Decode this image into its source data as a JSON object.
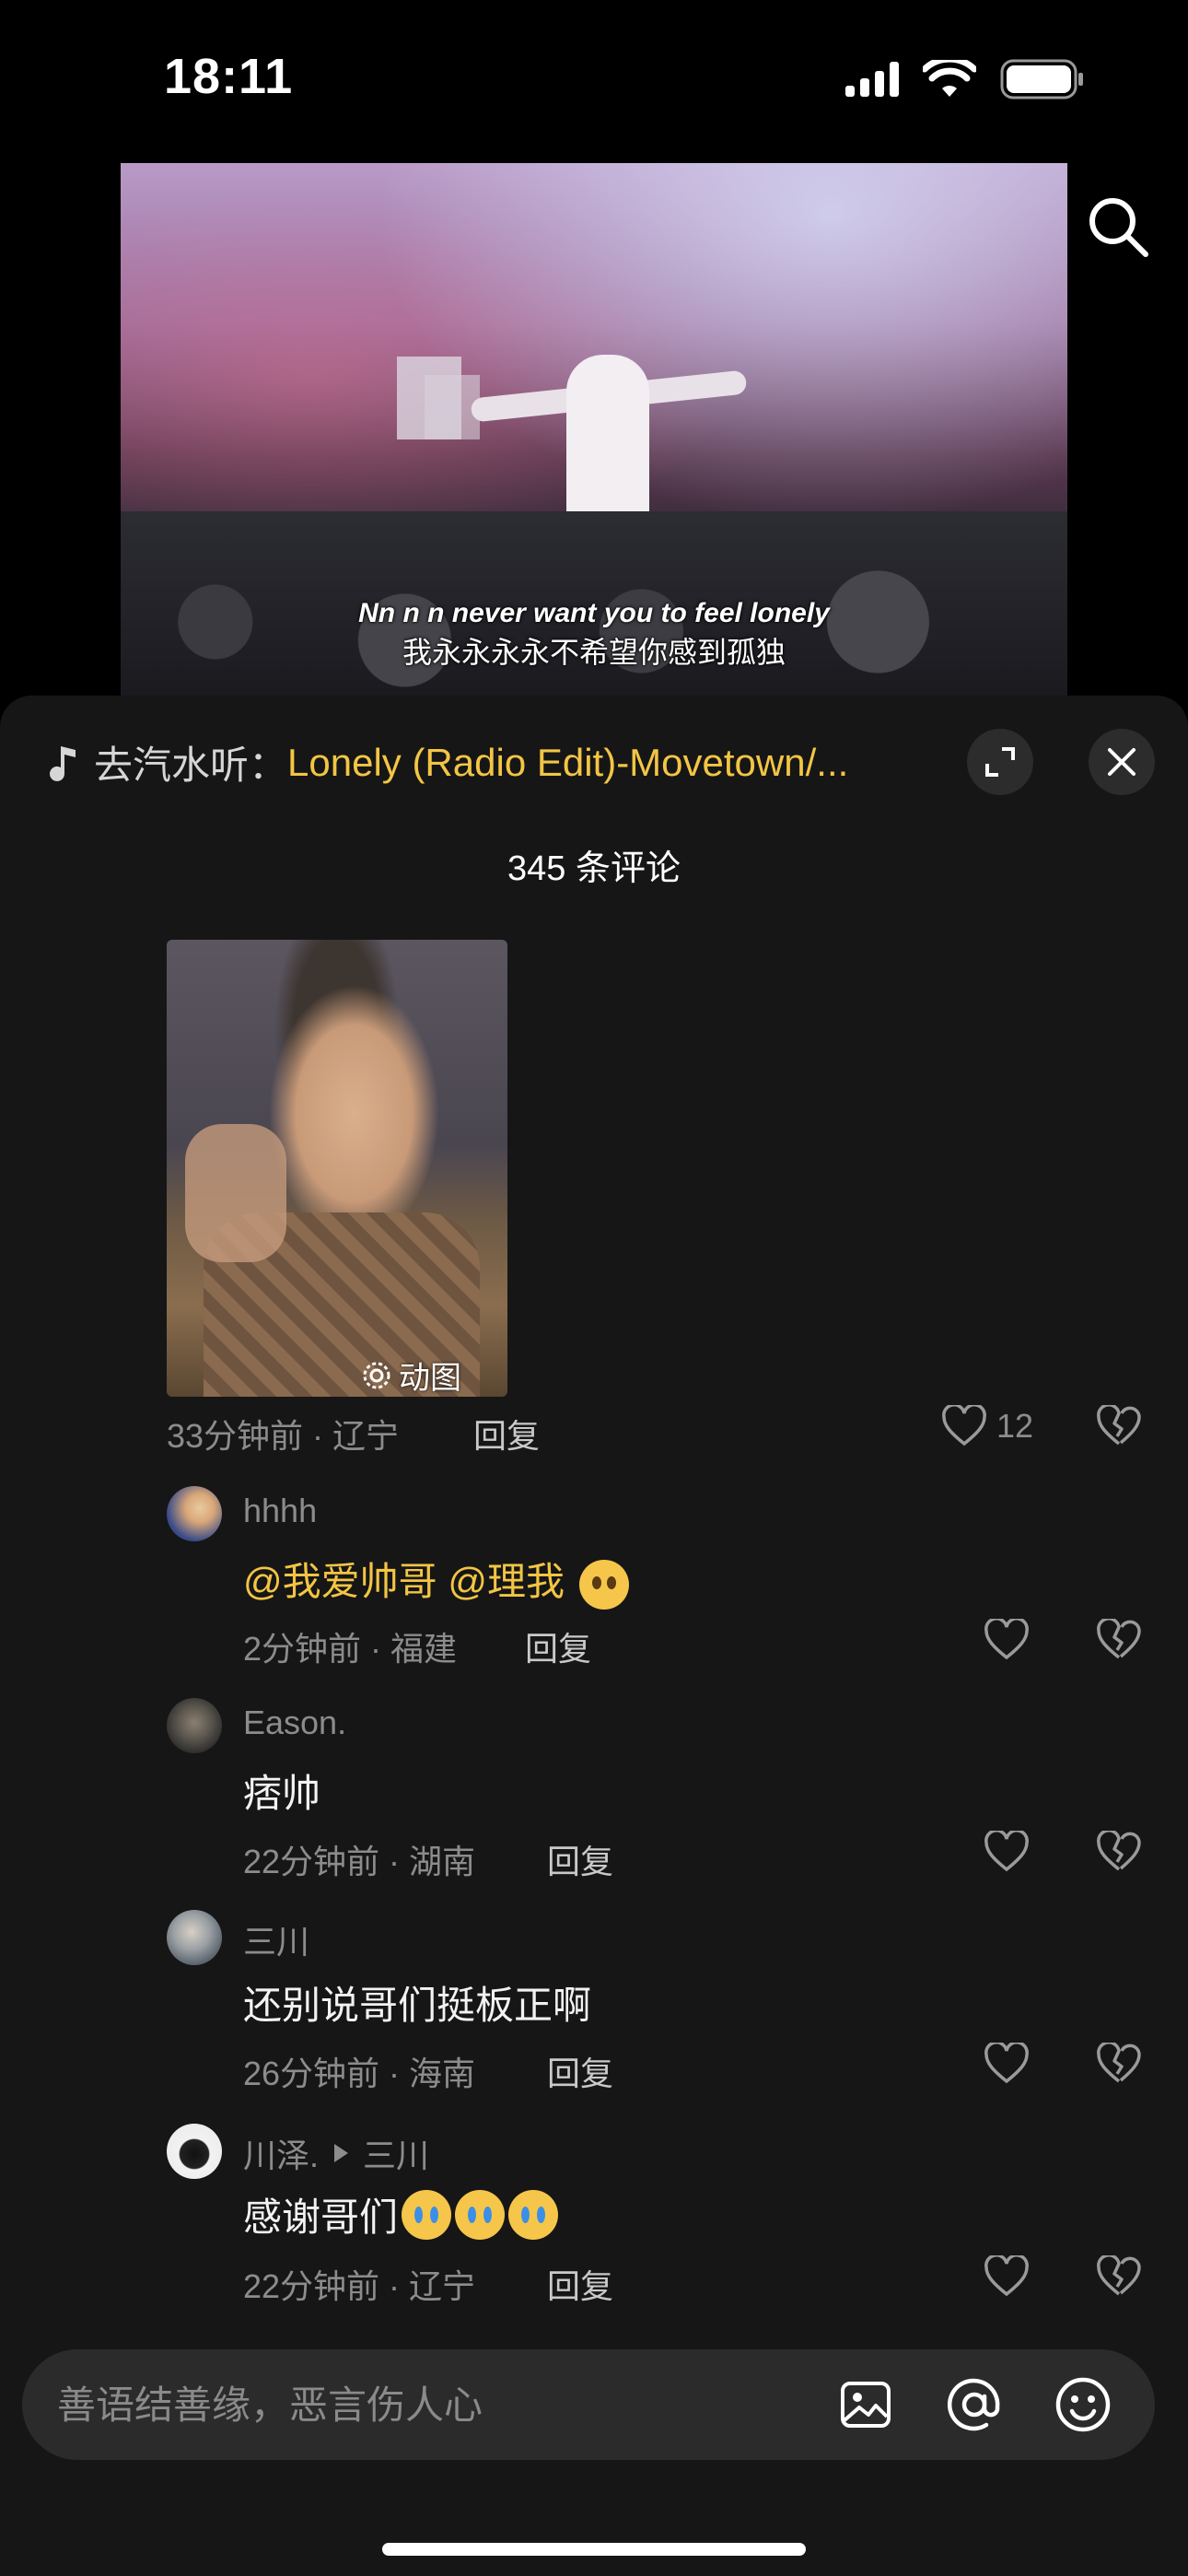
{
  "status_bar": {
    "time": "18:11"
  },
  "video": {
    "subtitle_en": "Nn n n never want you to feel lonely",
    "subtitle_zh": "我永永永永不希望你感到孤独"
  },
  "music": {
    "prefix": "去汽水听：",
    "song": "Lonely (Radio Edit)-Movetown/..."
  },
  "comments_header": {
    "count_label": "345 条评论"
  },
  "top_comment": {
    "gif_badge": "动图",
    "time_location": "33分钟前 · 辽宁",
    "reply_label": "回复",
    "like_count": "12"
  },
  "replies": [
    {
      "user": "hhhh",
      "mention1": "@我爱帅哥",
      "mention2": "@理我",
      "time_location": "2分钟前 · 福建",
      "reply_label": "回复"
    },
    {
      "user": "Eason.",
      "text": "痞帅",
      "time_location": "22分钟前 · 湖南",
      "reply_label": "回复"
    },
    {
      "user": "三川",
      "text": "还别说哥们挺板正啊",
      "time_location": "26分钟前 · 海南",
      "reply_label": "回复"
    },
    {
      "user": "川泽.",
      "reply_to": "三川",
      "text": "感谢哥们",
      "time_location": "22分钟前 · 辽宁",
      "reply_label": "回复"
    }
  ],
  "input": {
    "placeholder": "善语结善缘，恶言伤人心"
  },
  "colors": {
    "accent": "#f3c544",
    "sheet_bg": "#161616",
    "input_bg": "#2b2b2b"
  }
}
